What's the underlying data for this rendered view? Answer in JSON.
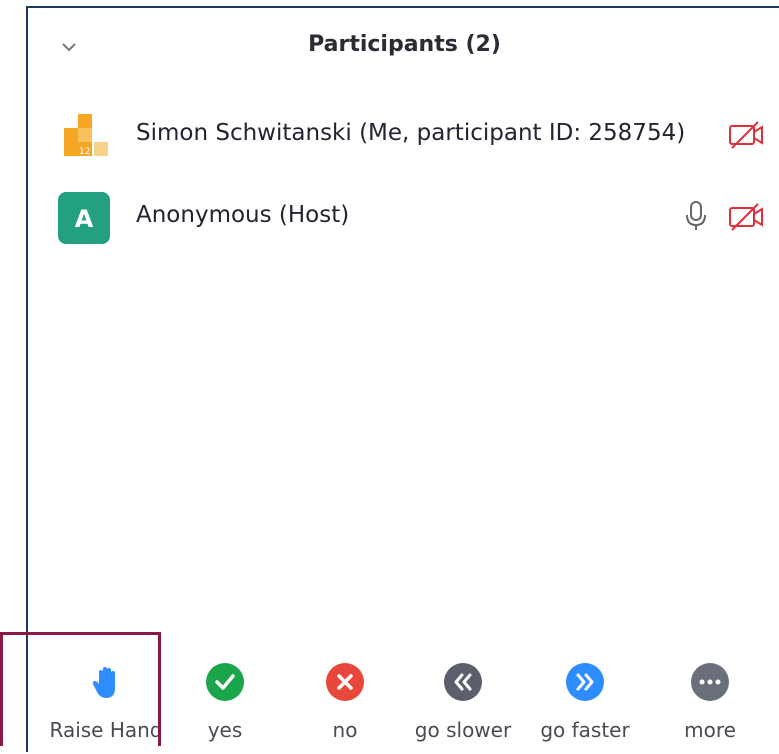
{
  "panel": {
    "title": "Participants (2)"
  },
  "participants": [
    {
      "name": "Simon Schwitanski (Me, participant ID: 258754)",
      "avatar_icon": "zoom-logo-avatar-icon",
      "video": "off"
    },
    {
      "name": "Anonymous (Host)",
      "avatar_letter": "A",
      "avatar_color": "#23a080",
      "mic": "unmuted",
      "video": "off"
    }
  ],
  "toolbar": {
    "raise_hand": "Raise Hand",
    "yes": "yes",
    "no": "no",
    "go_slower": "go slower",
    "go_faster": "go faster",
    "more": "more"
  },
  "colors": {
    "hand": "#2d8cff",
    "yes": "#1aa54b",
    "no": "#e8483b",
    "slower": "#5a5f6b",
    "faster": "#2d8cff",
    "more": "#6b6f7a",
    "video_off": "#e0303a",
    "highlight_border": "#8b1a4a"
  }
}
